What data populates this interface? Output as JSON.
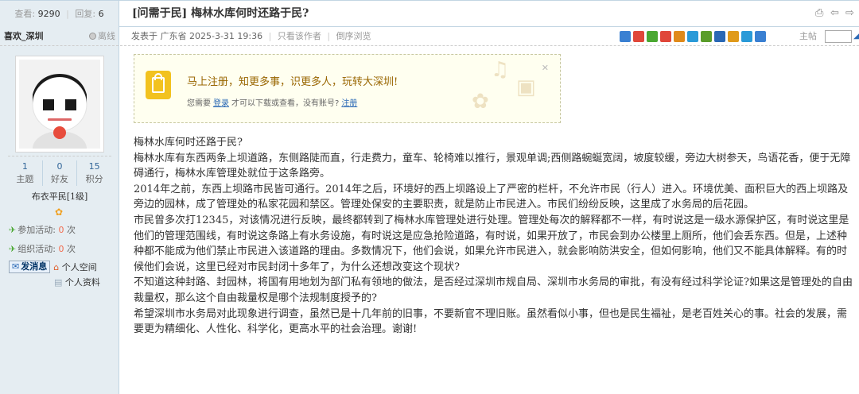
{
  "stats": {
    "views_label": "查看:",
    "views": "9290",
    "replies_label": "回复:",
    "replies": "6"
  },
  "thread": {
    "category": "[问需于民]",
    "title": "梅林水库何时还路于民?"
  },
  "author": {
    "name": "喜欢_深圳",
    "status": "离线",
    "threads_count": "1",
    "threads_label": "主题",
    "friends_count": "0",
    "friends_label": "好友",
    "points_count": "15",
    "points_label": "积分",
    "rank": "布衣平民[1级]",
    "activity1": "参加活动:",
    "activity1_value": "0",
    "activity1_unit": "次",
    "activity2": "组织活动:",
    "activity2_value": "0",
    "activity2_unit": "次",
    "message_button": "发消息",
    "space_link": "个人空间",
    "profile_link": "个人资料"
  },
  "post_meta": {
    "posted_at": "发表于 广东省 2025-3-31 19:36",
    "only_author": "只看该作者",
    "reverse": "倒序浏览",
    "floor_label": "主帖"
  },
  "share_colors": [
    "#3a80d2",
    "#e0473a",
    "#4aa832",
    "#e0473a",
    "#e08a1a",
    "#2a9ad8",
    "#5a9d2a",
    "#2968b5",
    "#e09a1a",
    "#2a9ad8",
    "#3a80d2"
  ],
  "notice": {
    "title": "马上注册，知更多事，识更多人，玩转大深圳!",
    "prefix": "您需要",
    "login": "登录",
    "middle": "才可以下载或查看，没有账号?",
    "register": "注册"
  },
  "body": {
    "p1": "梅林水库何时还路于民?",
    "p2": "梅林水库有东西两条上坝道路，东侧路陡而直，行走费力，童车、轮椅难以推行，景观单调;西侧路蜿蜒宽阔，坡度较缓，旁边大树参天，鸟语花香，便于无障碍通行，梅林水库管理处就位于这条路旁。",
    "p3": "2014年之前，东西上坝路市民皆可通行。2014年之后，环境好的西上坝路设上了严密的栏杆，不允许市民（行人）进入。环境优美、面积巨大的西上坝路及旁边的园林，成了管理处的私家花园和禁区。管理处保安的主要职责，就是防止市民进入。市民们纷纷反映，这里成了水务局的后花园。",
    "p4": "市民曾多次打12345，对该情况进行反映，最终都转到了梅林水库管理处进行处理。管理处每次的解释都不一样，有时说这是一级水源保护区，有时说这里是他们的管理范围线，有时说这条路上有水务设施，有时说这是应急抢险道路，有时说，如果开放了，市民会到办公楼里上厕所，他们会丢东西。但是，上述种种都不能成为他们禁止市民进入该道路的理由。多数情况下，他们会说，如果允许市民进入，就会影响防洪安全，但如何影响，他们又不能具体解释。有的时候他们会说，这里已经对市民封闭十多年了，为什么还想改变这个现状?",
    "p5": "不知道这种封路、封园林，将国有用地划为部门私有领地的做法，是否经过深圳市规自局、深圳市水务局的审批，有没有经过科学论证?如果这是管理处的自由裁量权，那么这个自由裁量权是哪个法规制度授予的?",
    "p6": "希望深圳市水务局对此现象进行调查，虽然已是十几年前的旧事，不要新官不理旧账。虽然看似小事，但也是民生福祉，是老百姓关心的事。社会的发展，需要更为精细化、人性化、科学化，更高水平的社会治理。谢谢!"
  }
}
